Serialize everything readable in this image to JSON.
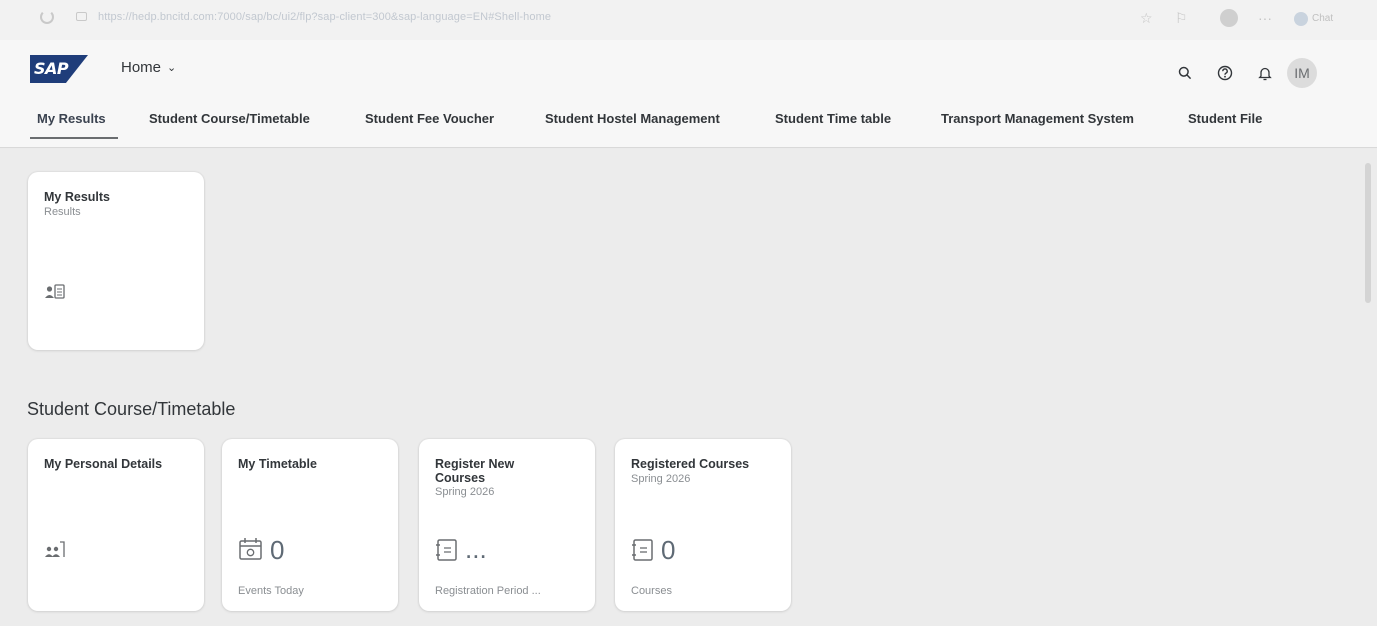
{
  "browser": {
    "url": "https://hedp.bncitd.com:7000/sap/bc/ui2/flp?sap-client=300&sap-language=EN#Shell-home",
    "chat_label": "Chat"
  },
  "shell": {
    "logo_text": "SAP",
    "home_label": "Home",
    "avatar_initials": "IM"
  },
  "anchor_nav": [
    {
      "label": "My Results"
    },
    {
      "label": "Student Course/Timetable"
    },
    {
      "label": "Student Fee Voucher"
    },
    {
      "label": "Student Hostel Management"
    },
    {
      "label": "Student Time table"
    },
    {
      "label": "Transport Management System"
    },
    {
      "label": "Student File"
    }
  ],
  "my_results_group": {
    "tile": {
      "title": "My Results",
      "subtitle": "Results",
      "icon": "user-report-icon"
    }
  },
  "course_group": {
    "title": "Student Course/Timetable",
    "tiles": [
      {
        "title": "My Personal Details",
        "subtitle": "",
        "icon": "personal-details-icon",
        "kpi": "",
        "footer": ""
      },
      {
        "title": "My Timetable",
        "subtitle": "",
        "icon": "calendar-icon",
        "kpi": "0",
        "footer": "Events Today"
      },
      {
        "title": "Register New Courses",
        "subtitle": "Spring 2026",
        "icon": "course-book-icon",
        "kpi": "...",
        "footer": "Registration Period ..."
      },
      {
        "title": "Registered Courses",
        "subtitle": "Spring 2026",
        "icon": "course-book-icon",
        "kpi": "0",
        "footer": "Courses"
      }
    ]
  },
  "colors": {
    "shell_bg": "#f7f7f7",
    "content_bg": "#ececec",
    "sap_blue": "#1f3d7a",
    "text": "#32363a",
    "subtle_text": "#8a8e92"
  }
}
